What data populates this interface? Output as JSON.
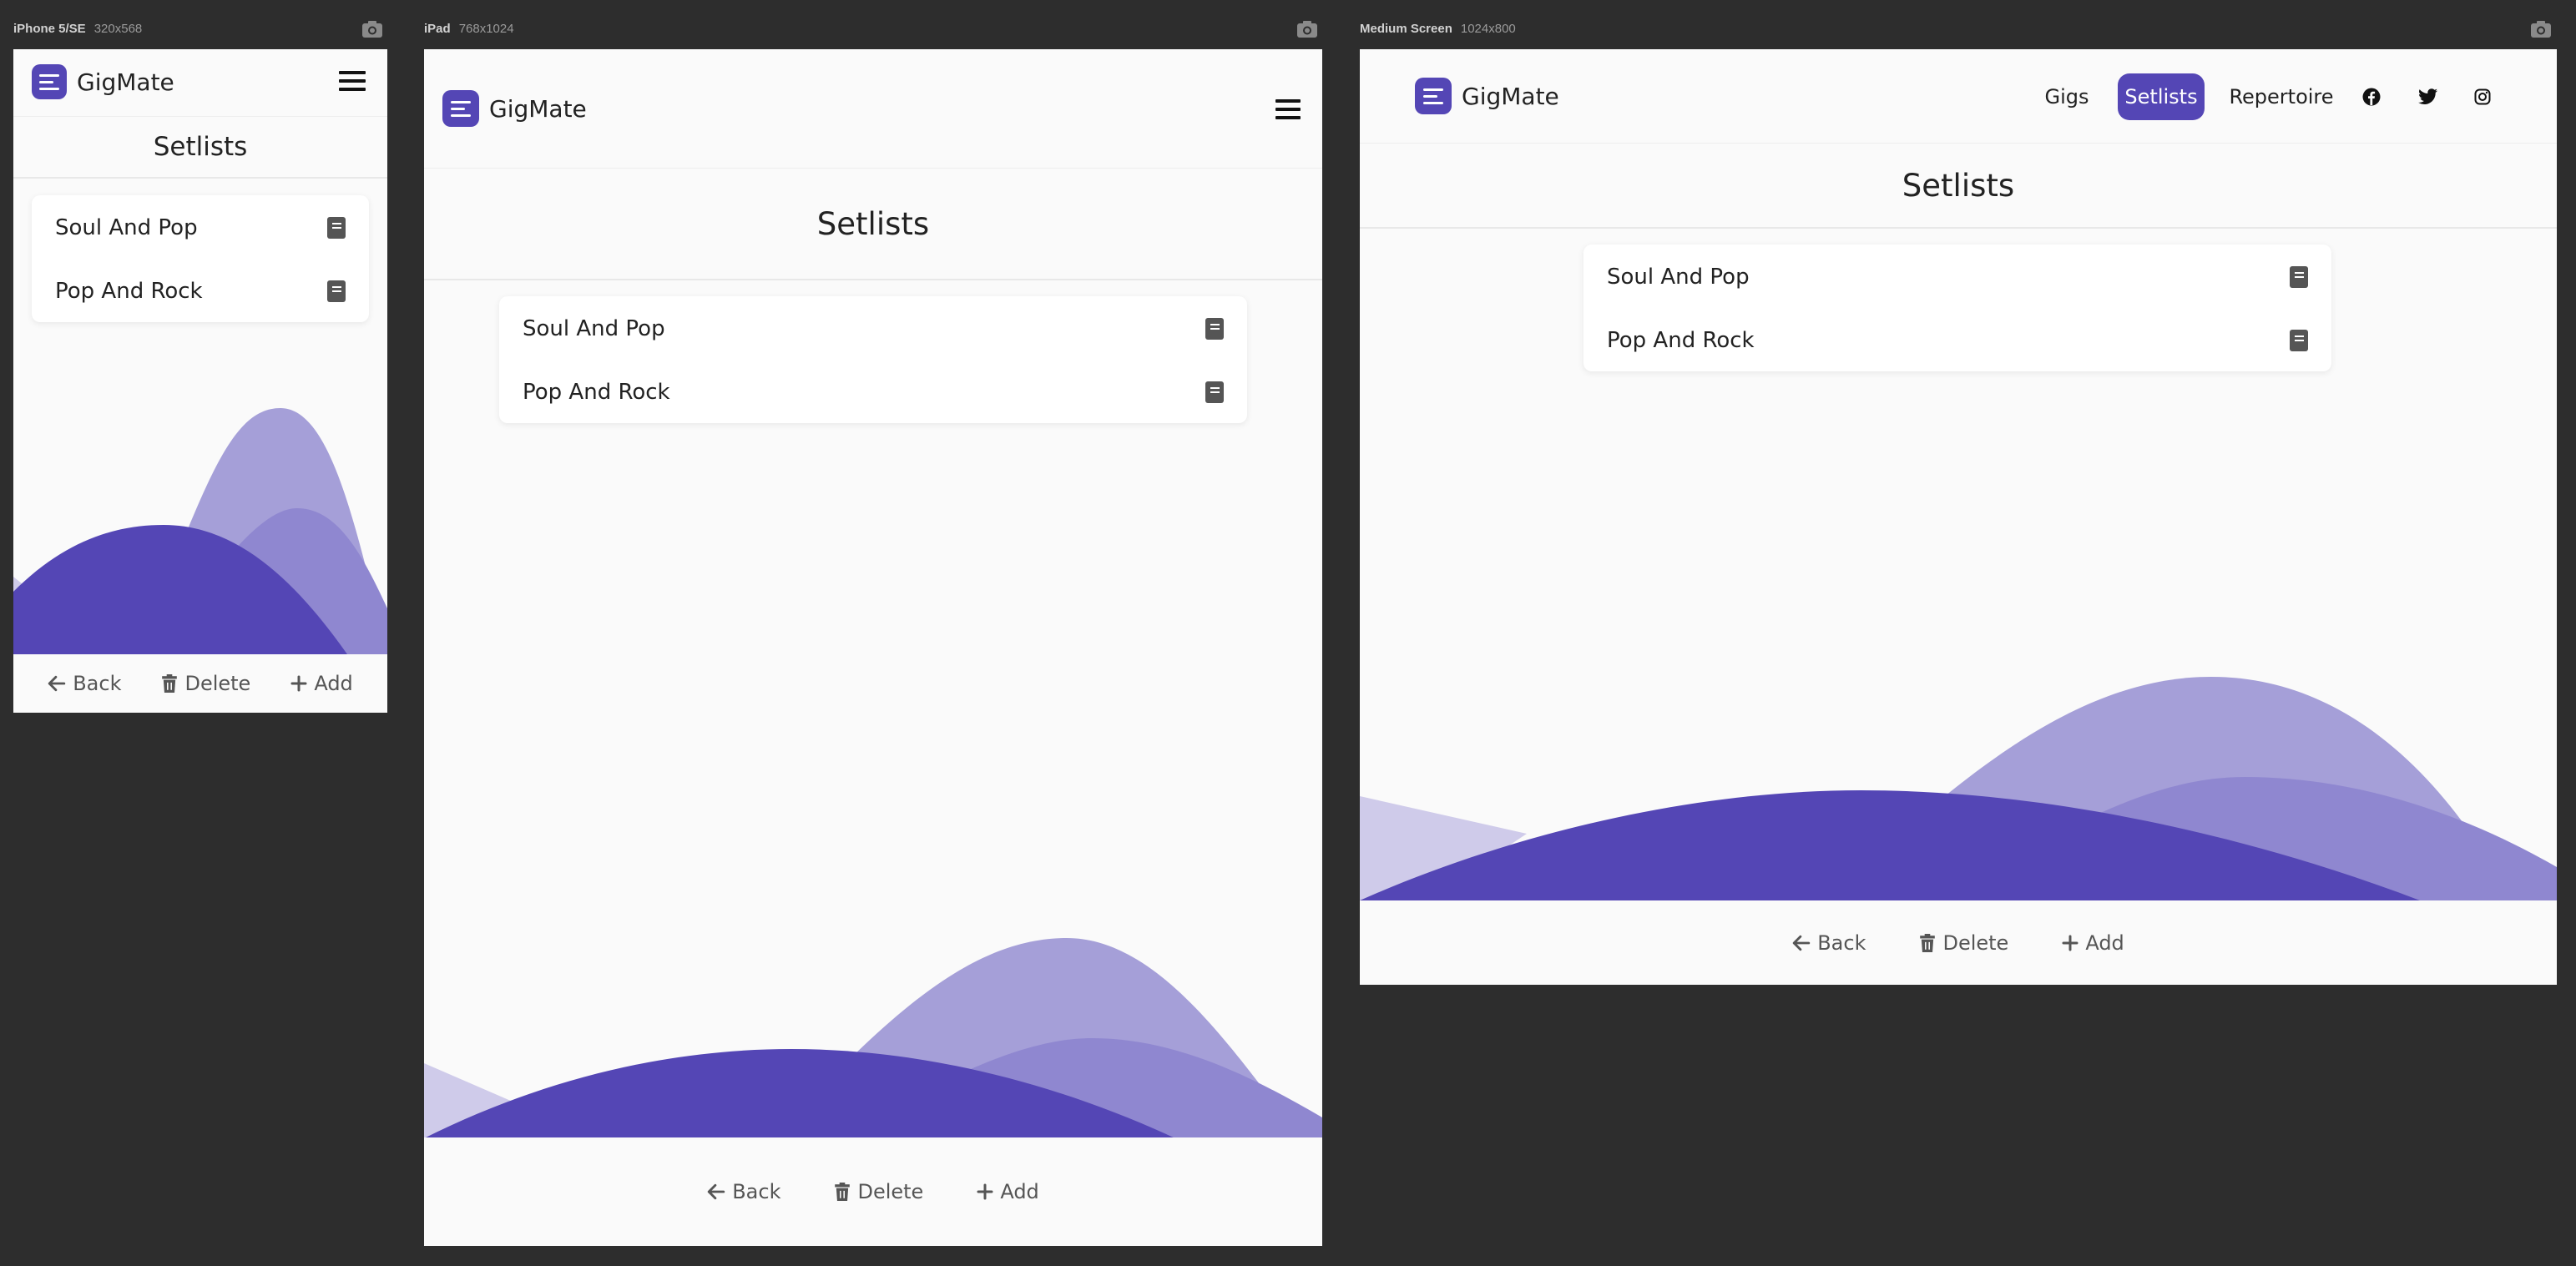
{
  "app": {
    "brand": "GigMate"
  },
  "viewports": [
    {
      "name": "iPhone 5/SE",
      "size": "320x568"
    },
    {
      "name": "iPad",
      "size": "768x1024"
    },
    {
      "name": "Medium Screen",
      "size": "1024x800"
    }
  ],
  "page": {
    "title": "Setlists"
  },
  "setlists": [
    {
      "name": "Soul And Pop"
    },
    {
      "name": "Pop And Rock"
    }
  ],
  "nav": {
    "gigs": "Gigs",
    "setlists": "Setlists",
    "repertoire": "Repertoire"
  },
  "footer": {
    "back": "Back",
    "delete": "Delete",
    "add": "Add"
  },
  "colors": {
    "accent": "#5446b5",
    "wave_light": "#a59fd8",
    "wave_mid": "#8f87d0",
    "wave_pale": "#cfcbea",
    "background": "#2d2d2d"
  },
  "icons": [
    "camera-icon",
    "hamburger-icon",
    "book-icon",
    "arrow-left-icon",
    "trash-icon",
    "plus-icon",
    "facebook-icon",
    "twitter-icon",
    "instagram-icon"
  ]
}
